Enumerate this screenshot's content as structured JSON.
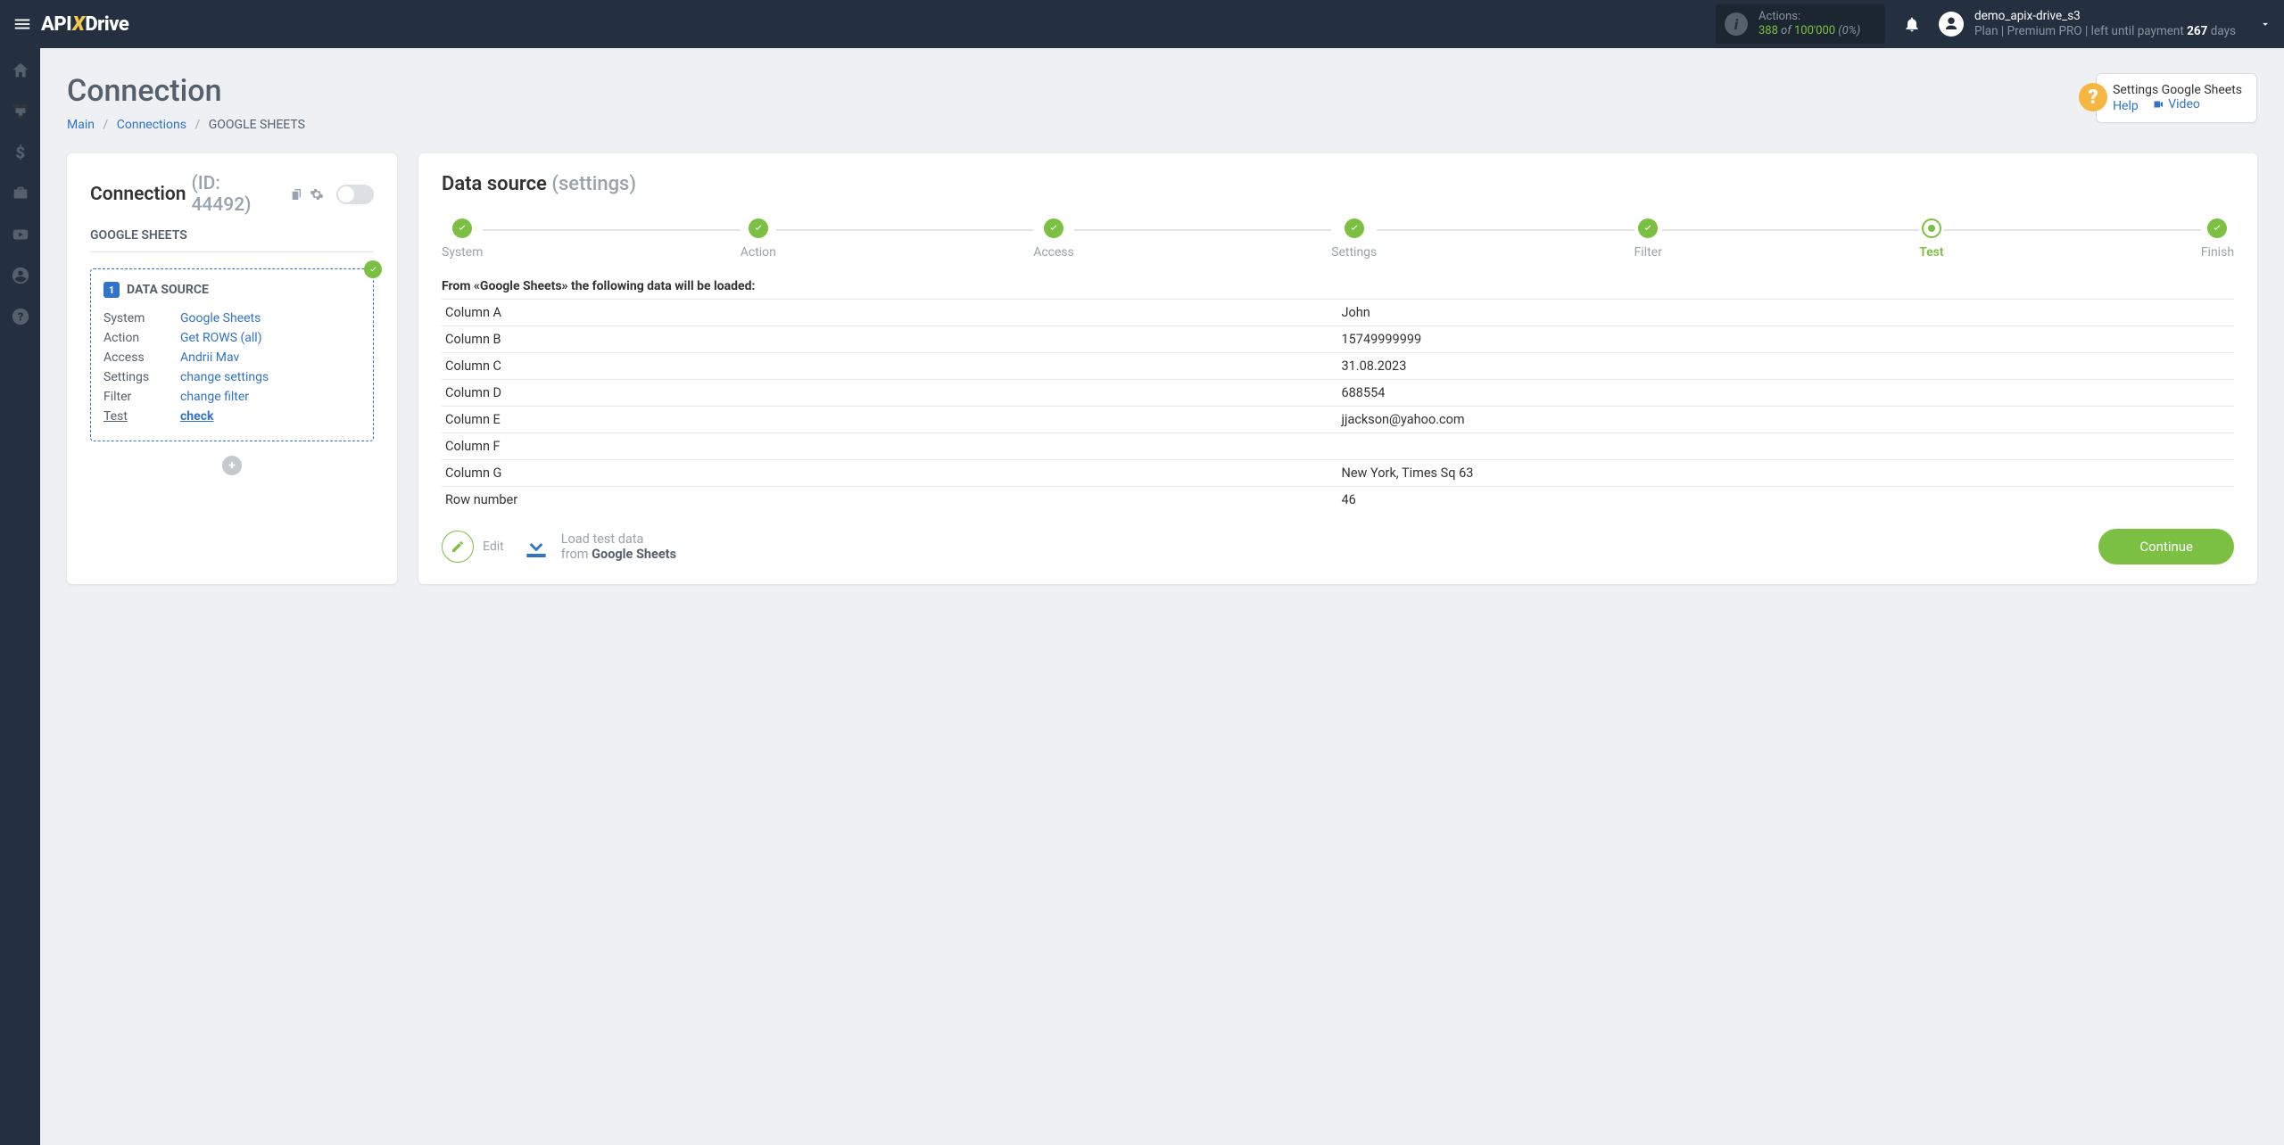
{
  "topbar": {
    "logo_prefix": "API",
    "logo_x": "X",
    "logo_suffix": "Drive",
    "actions_label": "Actions:",
    "actions_used": "388",
    "actions_of": "of",
    "actions_total": "100'000",
    "actions_pct": "(0%)",
    "user_name": "demo_apix-drive_s3",
    "plan_prefix": "Plan |",
    "plan_name": "Premium PRO",
    "plan_mid": "| left until payment",
    "plan_days_num": "267",
    "plan_days_word": "days"
  },
  "page": {
    "title": "Connection",
    "breadcrumb_main": "Main",
    "breadcrumb_connections": "Connections",
    "breadcrumb_current": "GOOGLE SHEETS"
  },
  "help": {
    "title": "Settings Google Sheets",
    "help_link": "Help",
    "video_link": "Video"
  },
  "left": {
    "conn_label": "Connection",
    "conn_id_label": "(ID: 44492)",
    "subtitle": "GOOGLE SHEETS",
    "ds_badge_num": "1",
    "ds_badge_label": "DATA SOURCE",
    "rows": {
      "system_k": "System",
      "system_v": "Google Sheets",
      "action_k": "Action",
      "action_v": "Get ROWS (all)",
      "access_k": "Access",
      "access_v": "Andrii Mav",
      "settings_k": "Settings",
      "settings_v": "change settings",
      "filter_k": "Filter",
      "filter_v": "change filter",
      "test_k": "Test",
      "test_v": "check"
    }
  },
  "right": {
    "title": "Data source",
    "title_sub": "(settings)",
    "steps": [
      "System",
      "Action",
      "Access",
      "Settings",
      "Filter",
      "Test",
      "Finish"
    ],
    "active_step_index": 5,
    "intro": "From «Google Sheets» the following data will be loaded:",
    "table": [
      {
        "k": "Column A",
        "v": "John"
      },
      {
        "k": "Column B",
        "v": "15749999999"
      },
      {
        "k": "Column C",
        "v": "31.08.2023"
      },
      {
        "k": "Column D",
        "v": "688554"
      },
      {
        "k": "Column E",
        "v": "jjackson@yahoo.com"
      },
      {
        "k": "Column F",
        "v": ""
      },
      {
        "k": "Column G",
        "v": "New York, Times Sq 63"
      },
      {
        "k": "Row number",
        "v": "46"
      }
    ],
    "edit_label": "Edit",
    "load_l1": "Load test data",
    "load_l2_from": "from",
    "load_l2_src": "Google Sheets",
    "continue": "Continue"
  }
}
